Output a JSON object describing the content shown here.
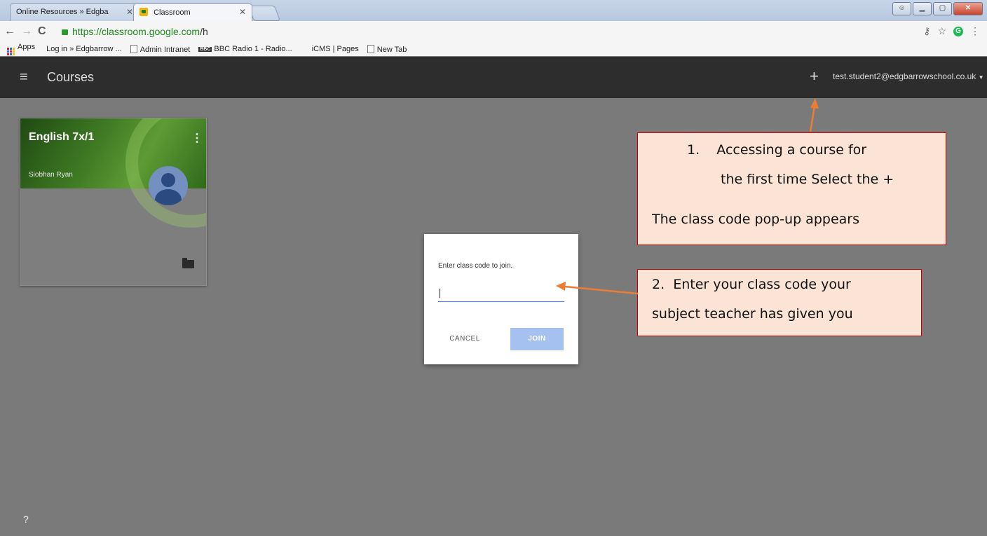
{
  "browser": {
    "tabs": [
      {
        "title": "Online Resources » Edgba",
        "active": false
      },
      {
        "title": "Classroom",
        "active": true
      }
    ],
    "url_secure": "https://classroom.google.com",
    "url_path": "/h",
    "bookmarks": [
      {
        "label": "Apps",
        "icon": "apps-grid-icon"
      },
      {
        "label": "Log in » Edgbarrow ...",
        "icon": "none"
      },
      {
        "label": "Admin Intranet",
        "icon": "page-icon"
      },
      {
        "label": "BBC Radio 1 - Radio...",
        "icon": "bbc-icon"
      },
      {
        "label": "iCMS | Pages",
        "icon": "none"
      },
      {
        "label": "New Tab",
        "icon": "page-icon"
      }
    ]
  },
  "header": {
    "title": "Courses",
    "add_label": "+",
    "account": "test.student2@edgbarrowschool.co.uk"
  },
  "course_card": {
    "title": "English 7x/1",
    "teacher": "Siobhan Ryan"
  },
  "dialog": {
    "prompt": "Enter class code to join.",
    "input_value": "",
    "cancel_label": "CANCEL",
    "join_label": "JOIN"
  },
  "help_label": "?",
  "callouts": {
    "step1_line1": "1.    Accessing a course for",
    "step1_line2": "the first time Select the +",
    "step1_line3": "The class code pop-up appears",
    "step2_line1": "2.  Enter your class code your",
    "step2_line2": "subject teacher has given you"
  },
  "colors": {
    "header_bg": "#2d2d2d",
    "page_bg": "#7a7a7a",
    "callout_bg": "#fbe4d5",
    "callout_border": "#cc0000",
    "arrow": "#ed7d31",
    "join_button": "#a5c1ef",
    "input_underline": "#4285f4"
  }
}
